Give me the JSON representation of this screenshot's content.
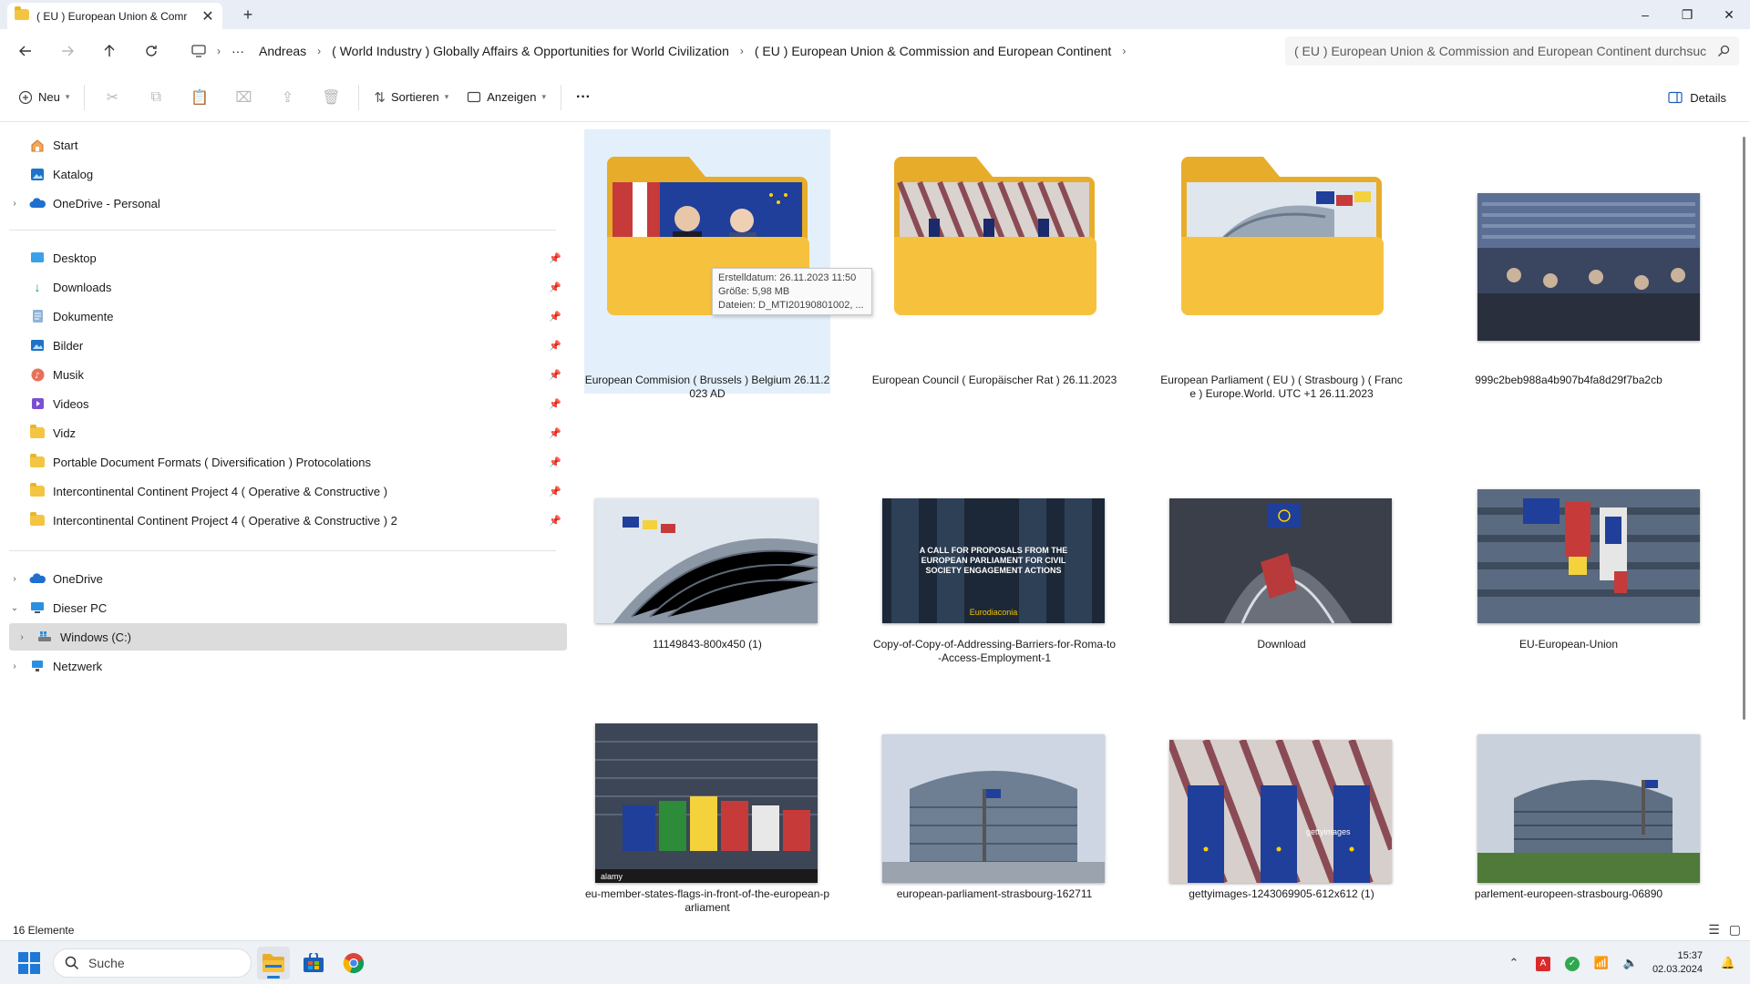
{
  "window": {
    "tab_title": "( EU ) European Union & Comr",
    "new_tab_symbol": "+",
    "minimize_symbol": "–",
    "maximize_symbol": "❐",
    "close_symbol": "✕"
  },
  "address": {
    "breadcrumb": [
      "···",
      "Andreas",
      "( World Industry ) Globally Affairs & Opportunities for World Civilization",
      "( EU ) European Union & Commission and European Continent"
    ],
    "search_placeholder": "( EU ) European Union & Commission and European Continent durchsuc"
  },
  "commandbar": {
    "new_label": "Neu",
    "sort_label": "Sortieren",
    "view_label": "Anzeigen",
    "more_label": "···",
    "details_label": "Details"
  },
  "sidebar": {
    "top_items": [
      "Start",
      "Katalog",
      "OneDrive - Personal"
    ],
    "pinned_items": [
      "Desktop",
      "Downloads",
      "Dokumente",
      "Bilder",
      "Musik",
      "Videos",
      "Vidz",
      "Portable Document Formats ( Diversification ) Protocolations",
      "Intercontinental Continent Project 4 ( Operative & Constructive )",
      "Intercontinental Continent Project 4 ( Operative & Constructive ) 2"
    ],
    "bottom_items": [
      "OneDrive",
      "Dieser PC",
      "Windows (C:)",
      "Netzwerk"
    ]
  },
  "tooltip": {
    "line1": "Erstelldatum: 26.11.2023 11:50",
    "line2": "Größe: 5,98 MB",
    "line3": "Dateien: D_MTI20190801002, ..."
  },
  "files": [
    {
      "label": "European Commision ( Brussels ) Belgium 26.11.2023 AD",
      "type": "folder"
    },
    {
      "label": "European Council ( Europäischer Rat ) 26.11.2023",
      "type": "folder"
    },
    {
      "label": "European Parliament ( EU ) ( Strasbourg ) ( France ) Europe.World. UTC +1 26.11.2023",
      "type": "folder"
    },
    {
      "label": "999c2beb988a4b907b4fa8d29f7ba2cb",
      "type": "image"
    },
    {
      "label": "11149843-800x450 (1)",
      "type": "image"
    },
    {
      "label": "Copy-of-Copy-of-Addressing-Barriers-for-Roma-to-Access-Employment-1",
      "type": "image"
    },
    {
      "label": "Download",
      "type": "image"
    },
    {
      "label": "EU-European-Union",
      "type": "image"
    },
    {
      "label": "eu-member-states-flags-in-front-of-the-european-parliament",
      "type": "image"
    },
    {
      "label": "european-parliament-strasbourg-162711",
      "type": "image"
    },
    {
      "label": "gettyimages-1243069905-612x612 (1)",
      "type": "image"
    },
    {
      "label": "parlement-europeen-strasbourg-06890",
      "type": "image"
    }
  ],
  "thumb_texts": {
    "call_title": "A CALL FOR PROPOSALS FROM THE EUROPEAN PARLIAMENT FOR CIVIL SOCIETY ENGAGEMENT ACTIONS",
    "call_brand": "Eurodiaconia",
    "alamy": "alamy",
    "getty": "gettyimages"
  },
  "status": {
    "count": "16 Elemente"
  },
  "taskbar": {
    "search_label": "Suche",
    "time": "15:37",
    "date": "02.03.2024"
  },
  "colors": {
    "folder_yellow": "#f6c23e",
    "folder_back": "#e7ad2a",
    "selection": "#e3f0fb",
    "accent": "#1d78d6",
    "eu_blue": "#1f3f9a"
  }
}
